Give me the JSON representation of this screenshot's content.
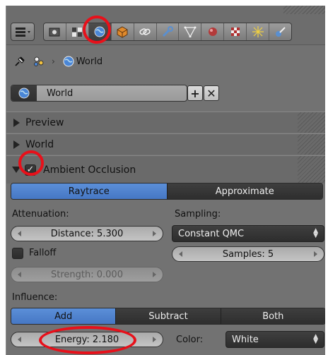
{
  "header": {
    "editor_type_icon": "properties-editor-icon",
    "context_icons": [
      "render-icon",
      "render-layers-icon",
      "world-icon",
      "object-icon",
      "constraints-icon",
      "modifiers-icon",
      "object-data-icon",
      "material-icon",
      "texture-icon",
      "particles-icon",
      "physics-icon"
    ],
    "active_context": "world-icon"
  },
  "breadcrumb": {
    "pin_icon": "pin-icon",
    "scene_icon": "scene-icon",
    "separator": "›",
    "world_label": "World"
  },
  "world_datablock": {
    "name": "World",
    "add_label": "+",
    "remove_label": "✕"
  },
  "panels": {
    "preview": "Preview",
    "world": "World",
    "ambient_occlusion": "Ambient Occlusion"
  },
  "ao": {
    "enabled": true,
    "methods": [
      "Raytrace",
      "Approximate"
    ],
    "active_method": "Raytrace",
    "attenuation_label": "Attenuation:",
    "distance": "Distance: 5.300",
    "falloff_label": "Falloff",
    "strength": "Strength: 0.000",
    "sampling_label": "Sampling:",
    "sampling_method": "Constant QMC",
    "samples": "Samples: 5",
    "influence_label": "Influence:",
    "blend_modes": [
      "Add",
      "Subtract",
      "Both"
    ],
    "active_blend": "Add",
    "energy": "Energy: 2.180",
    "color_label": "Color:",
    "color_value": "White"
  },
  "colors": {
    "panel_bg": "#727272",
    "accent_blue": "#5b8fd8",
    "highlight_ring": "#e8101a"
  }
}
